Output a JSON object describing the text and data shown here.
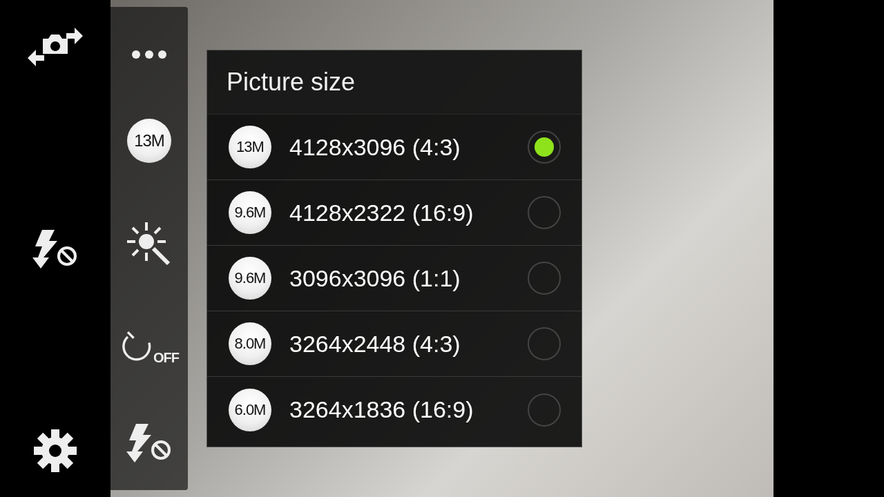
{
  "shortcut_panel": {
    "size_badge": "13M",
    "timer_label": "OFF"
  },
  "picture_size_dialog": {
    "title": "Picture size",
    "options": [
      {
        "badge": "13M",
        "label": "4128x3096 (4:3)",
        "selected": true
      },
      {
        "badge": "9.6M",
        "label": "4128x2322 (16:9)",
        "selected": false
      },
      {
        "badge": "9.6M",
        "label": "3096x3096 (1:1)",
        "selected": false
      },
      {
        "badge": "8.0M",
        "label": "3264x2448 (4:3)",
        "selected": false
      },
      {
        "badge": "6.0M",
        "label": "3264x1836 (16:9)",
        "selected": false
      }
    ]
  }
}
